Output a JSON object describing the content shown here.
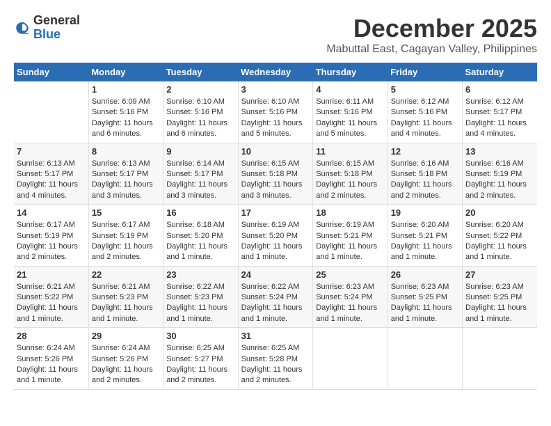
{
  "header": {
    "logo_general": "General",
    "logo_blue": "Blue",
    "month_year": "December 2025",
    "location": "Mabuttal East, Cagayan Valley, Philippines"
  },
  "days_of_week": [
    "Sunday",
    "Monday",
    "Tuesday",
    "Wednesday",
    "Thursday",
    "Friday",
    "Saturday"
  ],
  "weeks": [
    [
      {
        "day": "",
        "sunrise": "",
        "sunset": "",
        "daylight": ""
      },
      {
        "day": "1",
        "sunrise": "Sunrise: 6:09 AM",
        "sunset": "Sunset: 5:16 PM",
        "daylight": "Daylight: 11 hours and 6 minutes."
      },
      {
        "day": "2",
        "sunrise": "Sunrise: 6:10 AM",
        "sunset": "Sunset: 5:16 PM",
        "daylight": "Daylight: 11 hours and 6 minutes."
      },
      {
        "day": "3",
        "sunrise": "Sunrise: 6:10 AM",
        "sunset": "Sunset: 5:16 PM",
        "daylight": "Daylight: 11 hours and 5 minutes."
      },
      {
        "day": "4",
        "sunrise": "Sunrise: 6:11 AM",
        "sunset": "Sunset: 5:16 PM",
        "daylight": "Daylight: 11 hours and 5 minutes."
      },
      {
        "day": "5",
        "sunrise": "Sunrise: 6:12 AM",
        "sunset": "Sunset: 5:16 PM",
        "daylight": "Daylight: 11 hours and 4 minutes."
      },
      {
        "day": "6",
        "sunrise": "Sunrise: 6:12 AM",
        "sunset": "Sunset: 5:17 PM",
        "daylight": "Daylight: 11 hours and 4 minutes."
      }
    ],
    [
      {
        "day": "7",
        "sunrise": "Sunrise: 6:13 AM",
        "sunset": "Sunset: 5:17 PM",
        "daylight": "Daylight: 11 hours and 4 minutes."
      },
      {
        "day": "8",
        "sunrise": "Sunrise: 6:13 AM",
        "sunset": "Sunset: 5:17 PM",
        "daylight": "Daylight: 11 hours and 3 minutes."
      },
      {
        "day": "9",
        "sunrise": "Sunrise: 6:14 AM",
        "sunset": "Sunset: 5:17 PM",
        "daylight": "Daylight: 11 hours and 3 minutes."
      },
      {
        "day": "10",
        "sunrise": "Sunrise: 6:15 AM",
        "sunset": "Sunset: 5:18 PM",
        "daylight": "Daylight: 11 hours and 3 minutes."
      },
      {
        "day": "11",
        "sunrise": "Sunrise: 6:15 AM",
        "sunset": "Sunset: 5:18 PM",
        "daylight": "Daylight: 11 hours and 2 minutes."
      },
      {
        "day": "12",
        "sunrise": "Sunrise: 6:16 AM",
        "sunset": "Sunset: 5:18 PM",
        "daylight": "Daylight: 11 hours and 2 minutes."
      },
      {
        "day": "13",
        "sunrise": "Sunrise: 6:16 AM",
        "sunset": "Sunset: 5:19 PM",
        "daylight": "Daylight: 11 hours and 2 minutes."
      }
    ],
    [
      {
        "day": "14",
        "sunrise": "Sunrise: 6:17 AM",
        "sunset": "Sunset: 5:19 PM",
        "daylight": "Daylight: 11 hours and 2 minutes."
      },
      {
        "day": "15",
        "sunrise": "Sunrise: 6:17 AM",
        "sunset": "Sunset: 5:19 PM",
        "daylight": "Daylight: 11 hours and 2 minutes."
      },
      {
        "day": "16",
        "sunrise": "Sunrise: 6:18 AM",
        "sunset": "Sunset: 5:20 PM",
        "daylight": "Daylight: 11 hours and 1 minute."
      },
      {
        "day": "17",
        "sunrise": "Sunrise: 6:19 AM",
        "sunset": "Sunset: 5:20 PM",
        "daylight": "Daylight: 11 hours and 1 minute."
      },
      {
        "day": "18",
        "sunrise": "Sunrise: 6:19 AM",
        "sunset": "Sunset: 5:21 PM",
        "daylight": "Daylight: 11 hours and 1 minute."
      },
      {
        "day": "19",
        "sunrise": "Sunrise: 6:20 AM",
        "sunset": "Sunset: 5:21 PM",
        "daylight": "Daylight: 11 hours and 1 minute."
      },
      {
        "day": "20",
        "sunrise": "Sunrise: 6:20 AM",
        "sunset": "Sunset: 5:22 PM",
        "daylight": "Daylight: 11 hours and 1 minute."
      }
    ],
    [
      {
        "day": "21",
        "sunrise": "Sunrise: 6:21 AM",
        "sunset": "Sunset: 5:22 PM",
        "daylight": "Daylight: 11 hours and 1 minute."
      },
      {
        "day": "22",
        "sunrise": "Sunrise: 6:21 AM",
        "sunset": "Sunset: 5:23 PM",
        "daylight": "Daylight: 11 hours and 1 minute."
      },
      {
        "day": "23",
        "sunrise": "Sunrise: 6:22 AM",
        "sunset": "Sunset: 5:23 PM",
        "daylight": "Daylight: 11 hours and 1 minute."
      },
      {
        "day": "24",
        "sunrise": "Sunrise: 6:22 AM",
        "sunset": "Sunset: 5:24 PM",
        "daylight": "Daylight: 11 hours and 1 minute."
      },
      {
        "day": "25",
        "sunrise": "Sunrise: 6:23 AM",
        "sunset": "Sunset: 5:24 PM",
        "daylight": "Daylight: 11 hours and 1 minute."
      },
      {
        "day": "26",
        "sunrise": "Sunrise: 6:23 AM",
        "sunset": "Sunset: 5:25 PM",
        "daylight": "Daylight: 11 hours and 1 minute."
      },
      {
        "day": "27",
        "sunrise": "Sunrise: 6:23 AM",
        "sunset": "Sunset: 5:25 PM",
        "daylight": "Daylight: 11 hours and 1 minute."
      }
    ],
    [
      {
        "day": "28",
        "sunrise": "Sunrise: 6:24 AM",
        "sunset": "Sunset: 5:26 PM",
        "daylight": "Daylight: 11 hours and 1 minute."
      },
      {
        "day": "29",
        "sunrise": "Sunrise: 6:24 AM",
        "sunset": "Sunset: 5:26 PM",
        "daylight": "Daylight: 11 hours and 2 minutes."
      },
      {
        "day": "30",
        "sunrise": "Sunrise: 6:25 AM",
        "sunset": "Sunset: 5:27 PM",
        "daylight": "Daylight: 11 hours and 2 minutes."
      },
      {
        "day": "31",
        "sunrise": "Sunrise: 6:25 AM",
        "sunset": "Sunset: 5:28 PM",
        "daylight": "Daylight: 11 hours and 2 minutes."
      },
      {
        "day": "",
        "sunrise": "",
        "sunset": "",
        "daylight": ""
      },
      {
        "day": "",
        "sunrise": "",
        "sunset": "",
        "daylight": ""
      },
      {
        "day": "",
        "sunrise": "",
        "sunset": "",
        "daylight": ""
      }
    ]
  ]
}
